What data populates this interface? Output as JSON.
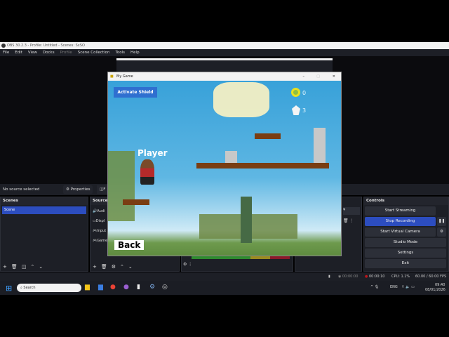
{
  "obs": {
    "title": "OBS 30.2.3 - Profile: Untitled - Scenes: SxSO",
    "menu": [
      "File",
      "Edit",
      "View",
      "Docks",
      "Profile",
      "Scene Collection",
      "Tools",
      "Help"
    ],
    "no_source": "No source selected",
    "properties": "Properties",
    "filters": "F",
    "scenes_title": "Scenes",
    "scenes": [
      "Scene"
    ],
    "sources_title": "Sources",
    "sources": [
      "Audi",
      "Displ",
      "Input",
      "Game"
    ],
    "controls_title": "Controls",
    "controls": [
      "Start Streaming",
      "Stop Recording",
      "Start Virtual Camera",
      "Studio Mode",
      "Settings",
      "Exit"
    ],
    "status": {
      "stream_time": "00:00:00",
      "rec_time": "00:00:10",
      "cpu": "CPU: 1.1%",
      "fps": "60.00 / 60.00 FPS"
    }
  },
  "game": {
    "title": "My Game",
    "shield_button": "Activate Shield",
    "coins": "0",
    "gems": "3",
    "player_label": "Player",
    "back_button": "Back"
  },
  "taskbar": {
    "search": "Search",
    "lang": "ENG",
    "time": "09:40",
    "date": "08/01/2026"
  },
  "colors": {
    "accent": "#2c4dbf",
    "recording": "#c0161b",
    "platform": "#7a3d12"
  }
}
